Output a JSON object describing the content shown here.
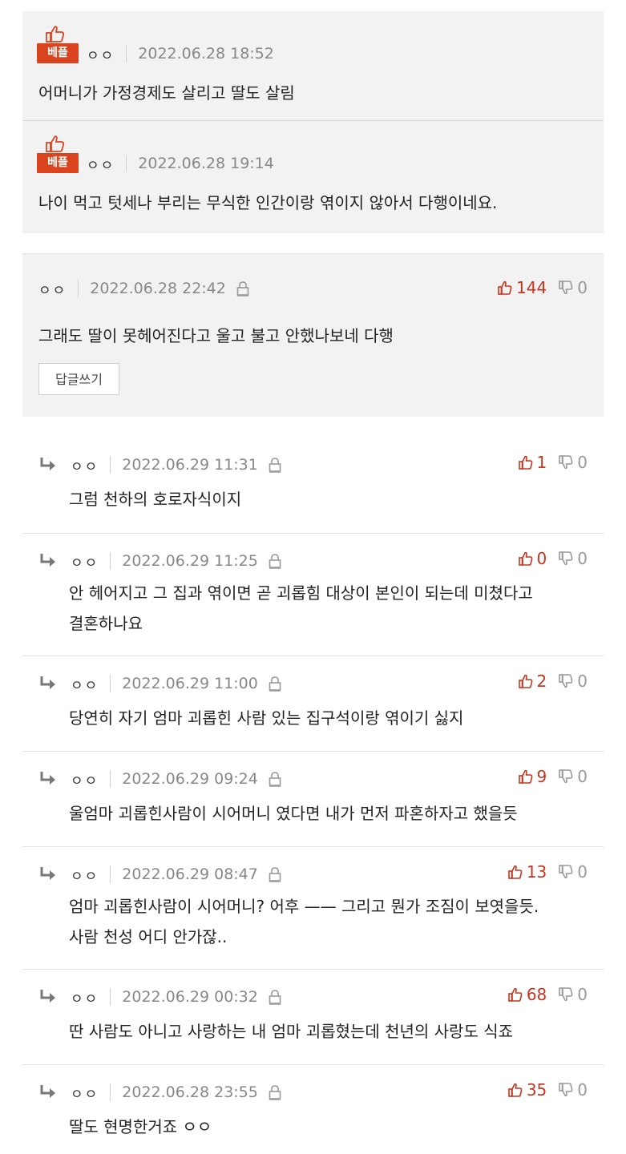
{
  "best_comments": [
    {
      "badge": "베플",
      "nick": "ㅇㅇ",
      "date": "2022.06.28 18:52",
      "text": "어머니가 가정경제도 살리고 딸도 살림"
    },
    {
      "badge": "베플",
      "nick": "ㅇㅇ",
      "date": "2022.06.28 19:14",
      "text": "나이 먹고 텃세나 부리는 무식한 인간이랑 엮이지 않아서 다행이네요."
    }
  ],
  "main_comment": {
    "nick": "ㅇㅇ",
    "date": "2022.06.28 22:42",
    "up": "144",
    "down": "0",
    "text": "그래도 딸이 못헤어진다고 울고 불고 안했나보네 다행",
    "reply_button": "답글쓰기"
  },
  "replies": [
    {
      "nick": "ㅇㅇ",
      "date": "2022.06.29 11:31",
      "up": "1",
      "down": "0",
      "lines": [
        "그럼 천하의 호로자식이지"
      ]
    },
    {
      "nick": "ㅇㅇ",
      "date": "2022.06.29 11:25",
      "up": "0",
      "down": "0",
      "lines": [
        "안 헤어지고 그 집과 엮이면 곧 괴롭힘 대상이 본인이 되는데 미쳤다고",
        "결혼하나요"
      ]
    },
    {
      "nick": "ㅇㅇ",
      "date": "2022.06.29 11:00",
      "up": "2",
      "down": "0",
      "lines": [
        "당연히 자기 엄마 괴롭힌 사람 있는 집구석이랑 엮이기 싫지"
      ]
    },
    {
      "nick": "ㅇㅇ",
      "date": "2022.06.29 09:24",
      "up": "9",
      "down": "0",
      "lines": [
        "울엄마 괴롭힌사람이 시어머니 였다면 내가 먼저 파혼하자고 했을듯"
      ]
    },
    {
      "nick": "ㅇㅇ",
      "date": "2022.06.29 08:47",
      "up": "13",
      "down": "0",
      "lines": [
        "엄마 괴롭힌사람이 시어머니? 어후 —— 그리고 뭔가 조짐이 보엿을듯.",
        "사람 천성 어디 안가잖.."
      ]
    },
    {
      "nick": "ㅇㅇ",
      "date": "2022.06.29 00:32",
      "up": "68",
      "down": "0",
      "lines": [
        "딴 사람도 아니고 사랑하는 내 엄마 괴롭혔는데 천년의 사랑도 식죠"
      ]
    },
    {
      "nick": "ㅇㅇ",
      "date": "2022.06.28 23:55",
      "up": "35",
      "down": "0",
      "lines": [
        "딸도 현명한거죠 ㅇㅇ"
      ]
    }
  ],
  "colors": {
    "accent": "#c3361f",
    "badge": "#d9441f",
    "box_bg": "#f2f2f2"
  },
  "icons": [
    "thumbs-up-icon",
    "thumbs-down-icon",
    "lock-icon",
    "reply-arrow-icon"
  ]
}
